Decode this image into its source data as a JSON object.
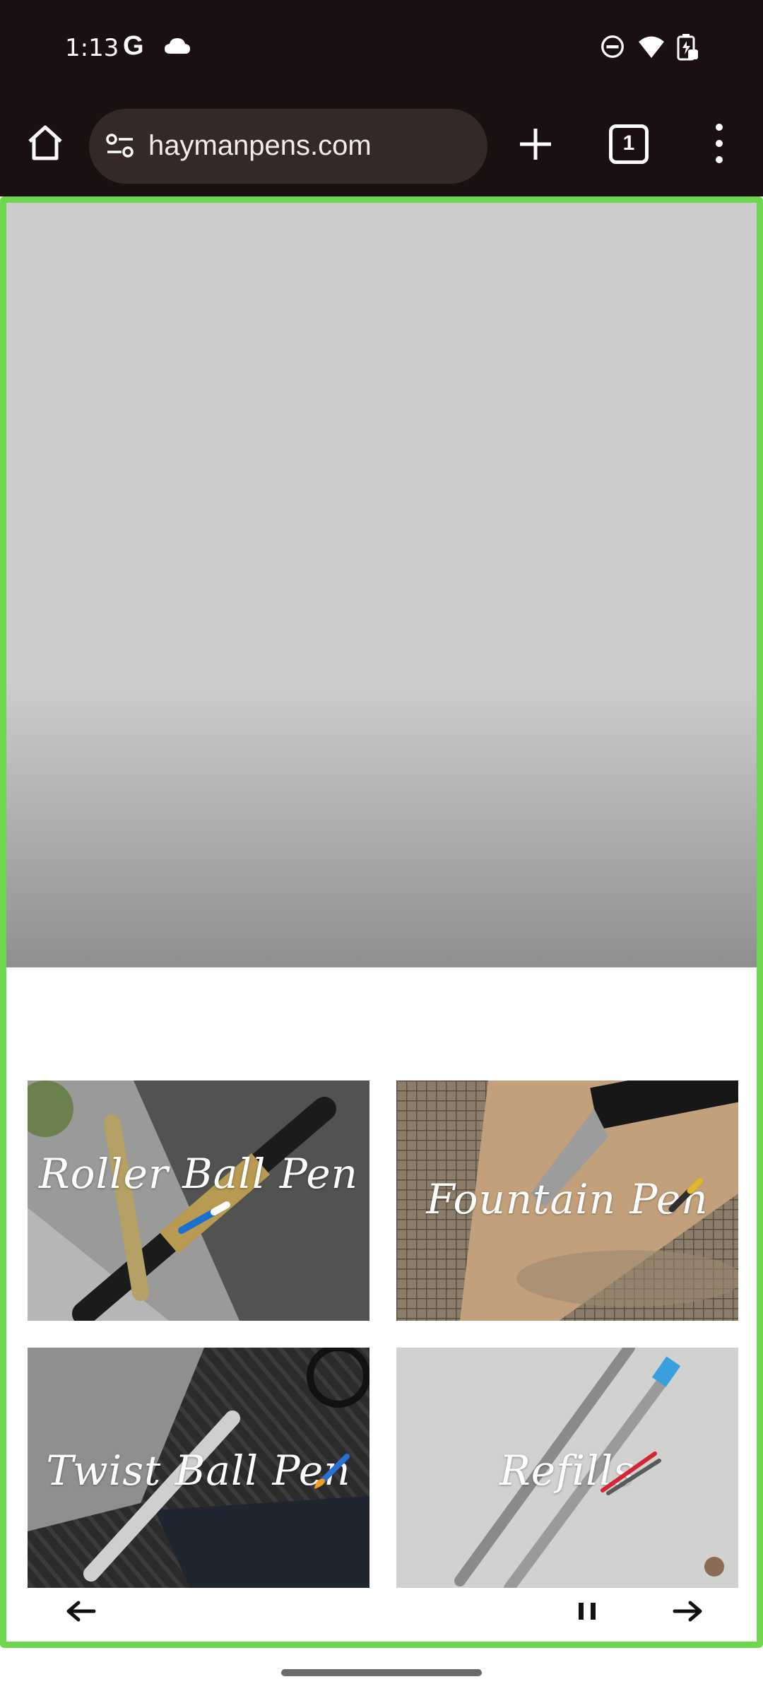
{
  "status_bar": {
    "time": "1:13",
    "g_label": "G",
    "icons": [
      "google-icon",
      "cloud-icon",
      "do-not-disturb-icon",
      "wifi-icon",
      "battery-charging-icon"
    ]
  },
  "browser": {
    "url": "haymanpens.com",
    "tab_count": "1",
    "icons": [
      "home-icon",
      "site-settings-icon",
      "plus-icon",
      "tabs-icon",
      "more-vert-icon"
    ]
  },
  "categories": [
    {
      "label": "Roller Ball Pen",
      "icon": "roller-pen-icon"
    },
    {
      "label": "Fountain Pen",
      "icon": "fountain-pen-icon"
    },
    {
      "label": "Twist Ball Pen",
      "icon": "paintbrush-icon"
    },
    {
      "label": "Refills",
      "icon": "refill-icon"
    }
  ],
  "carousel": {
    "controls": [
      "arrow-left-icon",
      "pause-icon",
      "arrow-right-icon"
    ]
  },
  "colors": {
    "browser_bg": "#1a1011",
    "url_bar_bg": "#352927",
    "highlight_border": "#6fd44e",
    "hero_gray": "#cccccc"
  }
}
